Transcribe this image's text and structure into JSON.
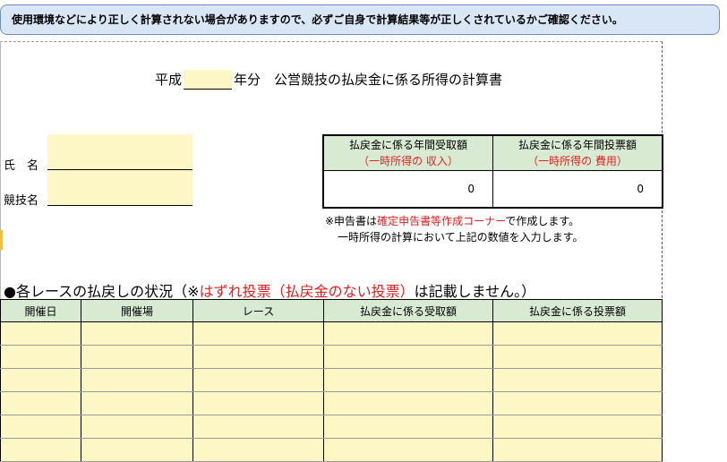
{
  "notice": "使用環境などにより正しく計算されない場合がありますので、必ずご自身で計算結果等が正しくされているかご確認ください。",
  "title": {
    "prefix": "平成",
    "suffix": "年分　公営競技の払戻金に係る所得の計算書"
  },
  "form": {
    "name_label": "氏　名",
    "sport_label": "競技名"
  },
  "summary": {
    "col1": {
      "header": "払戻金に係る年間受取額",
      "sub": "（一時所得の 収入）",
      "value": "0"
    },
    "col2": {
      "header": "払戻金に係る年間投票額",
      "sub": "（一時所得の 費用）",
      "value": "0"
    }
  },
  "note": {
    "prefix": "※申告書は",
    "link": "確定申告書等作成コーナー",
    "suffix": "で作成します。",
    "line2": "一時所得の計算において上記の数値を入力します。"
  },
  "status": {
    "prefix": "●各レースの払戻しの状況（※",
    "highlight": "はずれ投票（払戻金のない投票）",
    "suffix": "は記載しません。）"
  },
  "races": {
    "headers": [
      "開催日",
      "開催場",
      "レース",
      "払戻金に係る受取額",
      "払戻金に係る投票額"
    ],
    "row_count": 6
  },
  "colors": {
    "header_green": "#d9ead3",
    "input_yellow": "#fdf7c6",
    "accent_red": "#e02020",
    "notice_blue": "#d9e6f5"
  }
}
